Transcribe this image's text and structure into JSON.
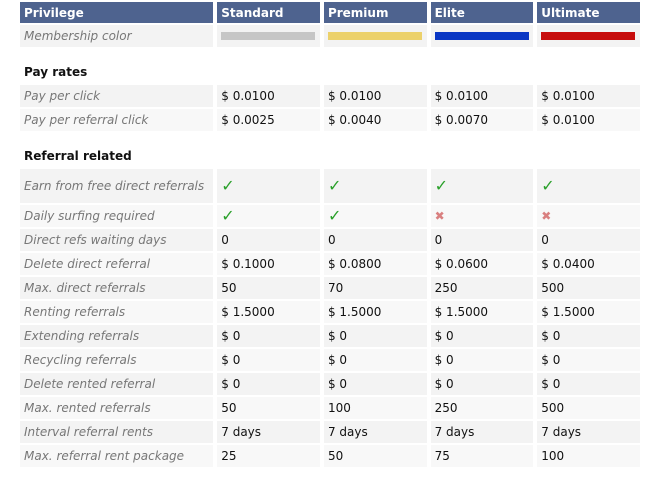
{
  "header": {
    "privilege": "Privilege",
    "levels": [
      "Standard",
      "Premium",
      "Elite",
      "Ultimate"
    ]
  },
  "membership": {
    "label": "Membership color",
    "colors": [
      "#c6c6c6",
      "#ecd16b",
      "#0a37c4",
      "#c70d0d"
    ]
  },
  "sections": {
    "pay_rates": "Pay rates",
    "referral_related": "Referral related"
  },
  "pay_rows": [
    {
      "label": "Pay per click",
      "values": [
        "$ 0.0100",
        "$ 0.0100",
        "$ 0.0100",
        "$ 0.0100"
      ]
    },
    {
      "label": "Pay per referral click",
      "values": [
        "$ 0.0025",
        "$ 0.0040",
        "$ 0.0070",
        "$ 0.0100"
      ]
    }
  ],
  "referral_rows": [
    {
      "label": "Earn from free direct referrals",
      "icons": [
        "check-icon",
        "check-icon",
        "check-icon",
        "check-icon"
      ]
    },
    {
      "label": "Daily surfing required",
      "icons": [
        "check-icon",
        "check-icon",
        "cross-icon",
        "cross-icon"
      ]
    },
    {
      "label": "Direct refs waiting days",
      "values": [
        "0",
        "0",
        "0",
        "0"
      ]
    },
    {
      "label": "Delete direct referral",
      "values": [
        "$ 0.1000",
        "$ 0.0800",
        "$ 0.0600",
        "$ 0.0400"
      ]
    },
    {
      "label": "Max. direct referrals",
      "values": [
        "50",
        "70",
        "250",
        "500"
      ]
    },
    {
      "label": "Renting referrals",
      "values": [
        "$ 1.5000",
        "$ 1.5000",
        "$ 1.5000",
        "$ 1.5000"
      ]
    },
    {
      "label": "Extending referrals",
      "values": [
        "$ 0",
        "$ 0",
        "$ 0",
        "$ 0"
      ]
    },
    {
      "label": "Recycling referrals",
      "values": [
        "$ 0",
        "$ 0",
        "$ 0",
        "$ 0"
      ]
    },
    {
      "label": "Delete rented referral",
      "values": [
        "$ 0",
        "$ 0",
        "$ 0",
        "$ 0"
      ]
    },
    {
      "label": "Max. rented referrals",
      "values": [
        "50",
        "100",
        "250",
        "500"
      ]
    },
    {
      "label": "Interval referral rents",
      "values": [
        "7 days",
        "7 days",
        "7 days",
        "7 days"
      ]
    },
    {
      "label": "Max. referral rent package",
      "values": [
        "25",
        "50",
        "75",
        "100"
      ]
    }
  ]
}
